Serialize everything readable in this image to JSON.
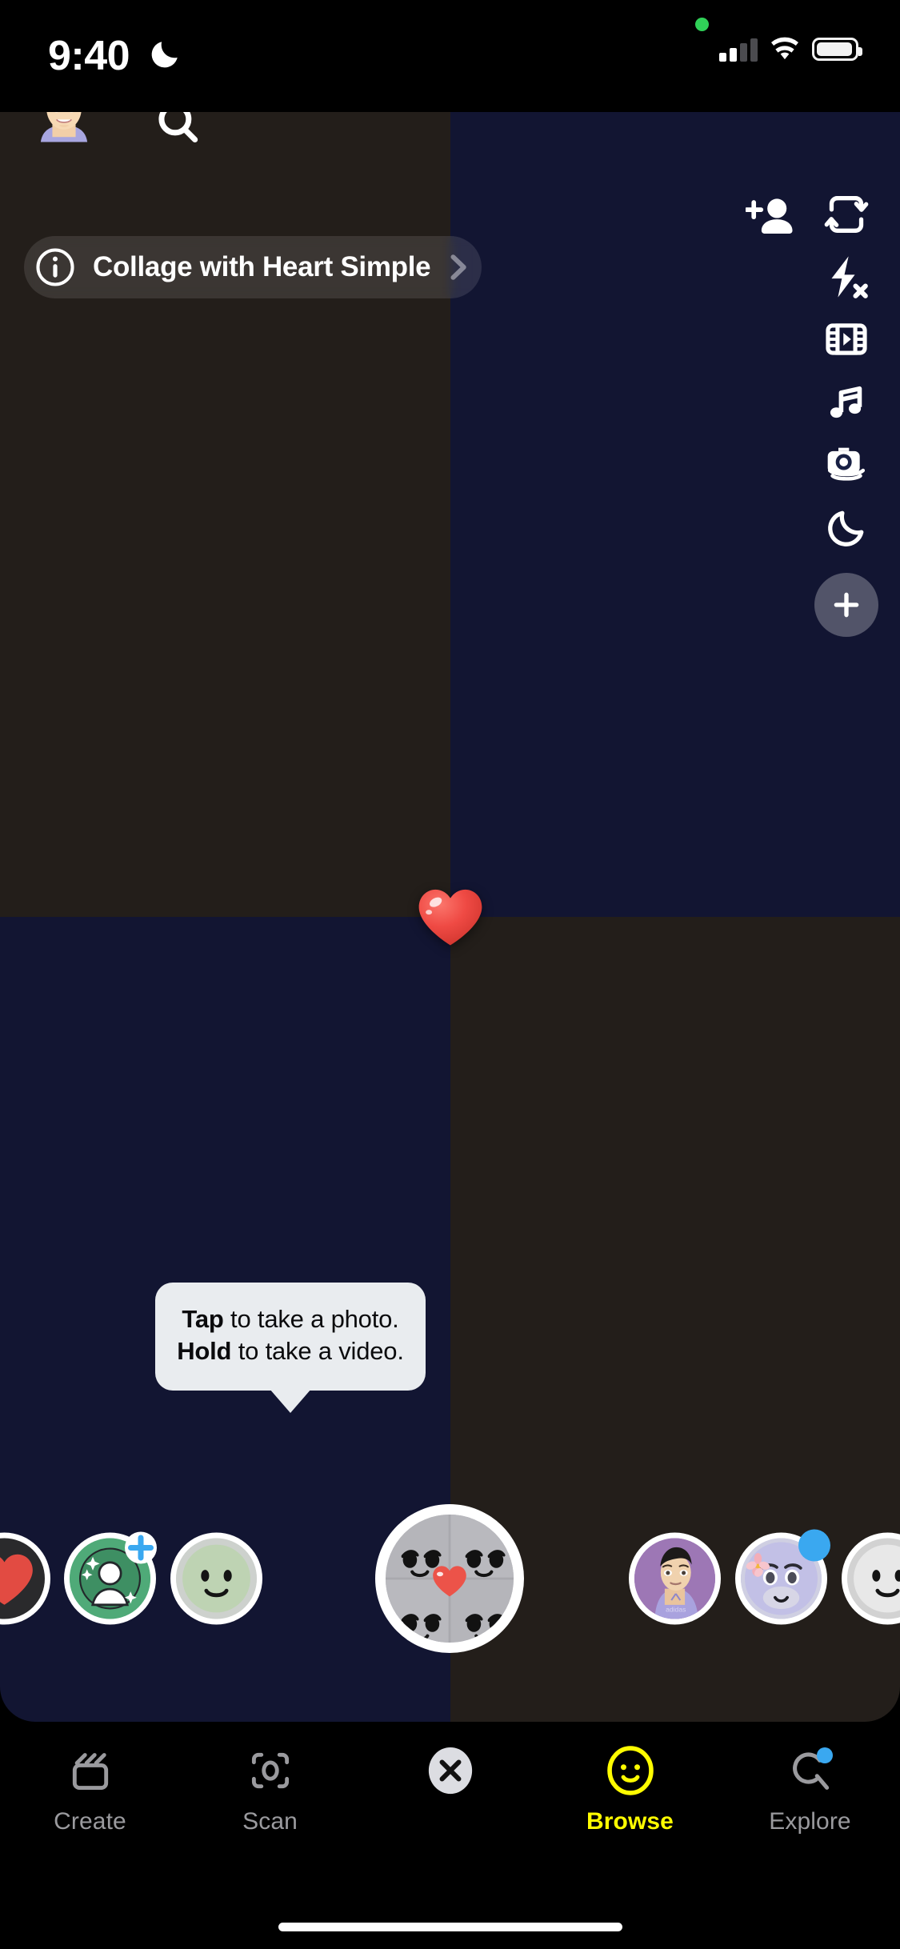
{
  "status_bar": {
    "time": "9:40",
    "dnd_icon": "crescent-moon-icon",
    "recording_dot_color": "#30d158",
    "signal_icon": "cellular-signal-icon",
    "wifi_icon": "wifi-icon",
    "battery_icon": "battery-icon",
    "battery_level_pct": 84
  },
  "top_bar": {
    "avatar_name": "bitmoji-avatar",
    "avatar_badge_color": "#fffc00",
    "search_icon": "search-icon",
    "add_friend_icon": "add-friend-icon"
  },
  "lens_info": {
    "info_icon": "info-circle-icon",
    "title": "Collage with Heart Simple",
    "chevron_icon": "chevron-right-icon"
  },
  "camera_rail": [
    {
      "name": "flip-camera-icon",
      "label": "Flip Camera"
    },
    {
      "name": "flash-off-icon",
      "label": "Flash Off"
    },
    {
      "name": "timer-filmstrip-icon",
      "label": "Timer"
    },
    {
      "name": "music-note-icon",
      "label": "Sounds"
    },
    {
      "name": "multi-snap-camera-icon",
      "label": "Multi Snap"
    },
    {
      "name": "night-mode-moon-icon",
      "label": "Night Mode"
    },
    {
      "name": "add-more-tools-icon",
      "label": "More Tools"
    }
  ],
  "viewfinder": {
    "quadrant_colors": [
      "#231e1a",
      "#121532",
      "#121532",
      "#231e1a"
    ],
    "overlay_icon": "red-heart-overlay",
    "overlay_color": "#ef4a44"
  },
  "tooltip": {
    "line1_bold": "Tap",
    "line1_rest": " to take a photo.",
    "line2_bold": "Hold",
    "line2_rest": " to take a video.",
    "background": "#e9ecef"
  },
  "carousel": {
    "lenses": [
      {
        "name": "lens-heart-dark",
        "label": "Heart Lens",
        "selected": false
      },
      {
        "name": "lens-create-your-own",
        "label": "Create Your Own",
        "selected": false,
        "badge": "blue-plus-badge"
      },
      {
        "name": "lens-green-smiley",
        "label": "Green Smiley Lens",
        "selected": false
      },
      {
        "name": "lens-collage-with-heart-simple",
        "label": "Collage with Heart Simple",
        "selected": true
      },
      {
        "name": "lens-bitmoji-purple",
        "label": "Bitmoji Lens",
        "selected": false
      },
      {
        "name": "lens-lavender-flower-face",
        "label": "Lavender Flower Face",
        "selected": false,
        "badge": "group-lens-badge"
      },
      {
        "name": "lens-white-smiley",
        "label": "White Smiley Lens",
        "selected": false
      }
    ]
  },
  "bottom_nav": {
    "items": [
      {
        "label": "Create",
        "icon": "create-clapperboard-icon",
        "active": false
      },
      {
        "label": "Scan",
        "icon": "scan-brackets-icon",
        "active": false
      },
      {
        "label": "",
        "icon": "close-x-icon",
        "active": false
      },
      {
        "label": "Browse",
        "icon": "browse-smiley-icon",
        "active": true
      },
      {
        "label": "Explore",
        "icon": "explore-search-icon",
        "active": false,
        "badge": true
      }
    ],
    "active_color": "#fffc00",
    "inactive_color": "#9a9a9e"
  }
}
